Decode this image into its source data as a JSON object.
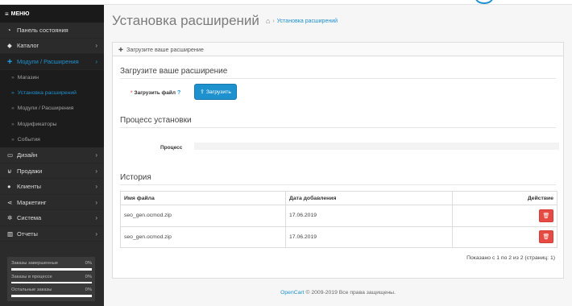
{
  "sidebar": {
    "menu_title": "МЕНЮ",
    "items": [
      {
        "label": "Панель состояния",
        "icon": "dashboard-icon"
      },
      {
        "label": "Каталог",
        "icon": "tag-icon"
      },
      {
        "label": "Модули / Расширения",
        "icon": "puzzle-icon"
      },
      {
        "label": "Дизайн",
        "icon": "monitor-icon"
      },
      {
        "label": "Продажи",
        "icon": "cart-icon"
      },
      {
        "label": "Клиенты",
        "icon": "user-icon"
      },
      {
        "label": "Маркетинг",
        "icon": "share-icon"
      },
      {
        "label": "Система",
        "icon": "cog-icon"
      },
      {
        "label": "Отчеты",
        "icon": "bar-chart-icon"
      }
    ],
    "submenu": [
      {
        "label": "Магазин"
      },
      {
        "label": "Установка расширений"
      },
      {
        "label": "Модули / Расширения"
      },
      {
        "label": "Модификаторы"
      },
      {
        "label": "События"
      }
    ],
    "stats": [
      {
        "label": "Заказы завершенные",
        "value": "0%",
        "progress": 0
      },
      {
        "label": "Заказы в процессе",
        "value": "0%",
        "progress": 0
      },
      {
        "label": "Остальные заказы",
        "value": "0%",
        "progress": 0
      }
    ]
  },
  "header": {
    "title": "Установка расширений",
    "breadcrumb_sep": "›",
    "breadcrumb": "Установка расширений"
  },
  "panel": {
    "heading": "Загрузите ваше расширение",
    "upload_legend": "Загрузите ваше расширение",
    "upload_label": "Загрузить файл",
    "upload_button": "Загрузить",
    "progress_legend": "Процесс установки",
    "progress_label": "Процесс",
    "progress_value": 0,
    "history_legend": "История",
    "columns": {
      "filename": "Имя файла",
      "date": "Дата добавления",
      "action": "Действие"
    },
    "rows": [
      {
        "filename": "seo_gen.ocmod.zip",
        "date": "17.06.2019"
      },
      {
        "filename": "seo_gen.ocmod.zip",
        "date": "17.06.2019"
      }
    ],
    "pagination": "Показано с 1 по 2 из 2 (страниц: 1)"
  },
  "footer": {
    "link": "OpenCart",
    "text": " © 2009-2019 Все права защищены."
  },
  "colors": {
    "accent": "#1e91cf",
    "danger": "#e54b43",
    "sidebar": "#2b2b2b"
  }
}
